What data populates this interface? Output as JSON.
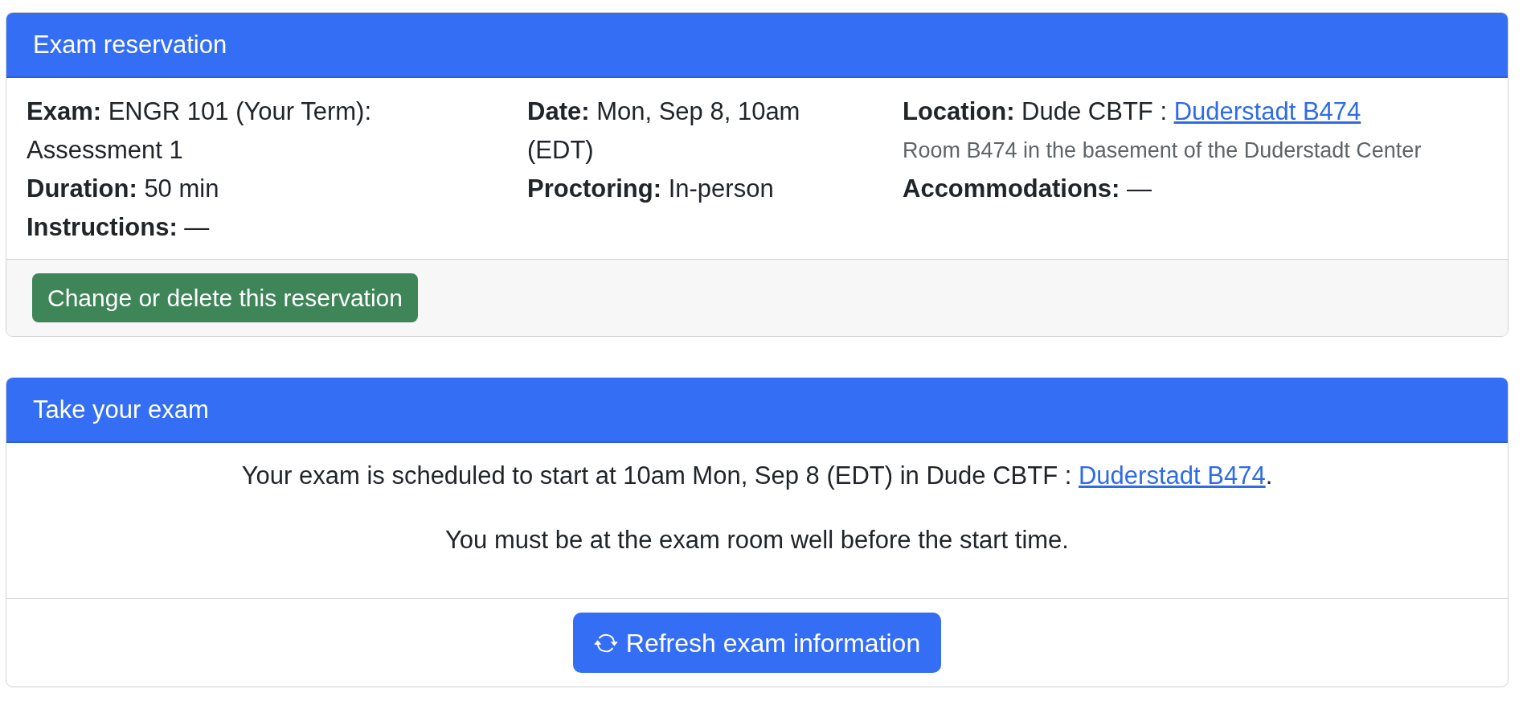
{
  "reservation_card": {
    "title": "Exam reservation",
    "columns": [
      [
        {
          "label": "Exam:",
          "value": "ENGR 101 (Your Term): Assessment 1"
        },
        {
          "label": "Duration:",
          "value": "50 min"
        },
        {
          "label": "Instructions:",
          "value": "—"
        }
      ],
      [
        {
          "label": "Date:",
          "value": "Mon, Sep 8, 10am (EDT)"
        },
        {
          "label": "Proctoring:",
          "value": "In-person"
        }
      ],
      [
        {
          "label": "Location:",
          "value": "Dude CBTF :",
          "link": "Duderstadt B474",
          "note": "Room B474 in the basement of the Duderstadt Center"
        },
        {
          "label": "Accommodations:",
          "value": "—"
        }
      ]
    ],
    "button": "Change or delete this reservation"
  },
  "exam_card": {
    "title": "Take your exam",
    "message": {
      "text": "Your exam is scheduled to start at 10am Mon, Sep 8 (EDT) in Dude CBTF :",
      "link": "Duderstadt B474",
      "after": "."
    },
    "notice": "You must be at the exam room well before the start time.",
    "button": "Refresh exam information"
  }
}
